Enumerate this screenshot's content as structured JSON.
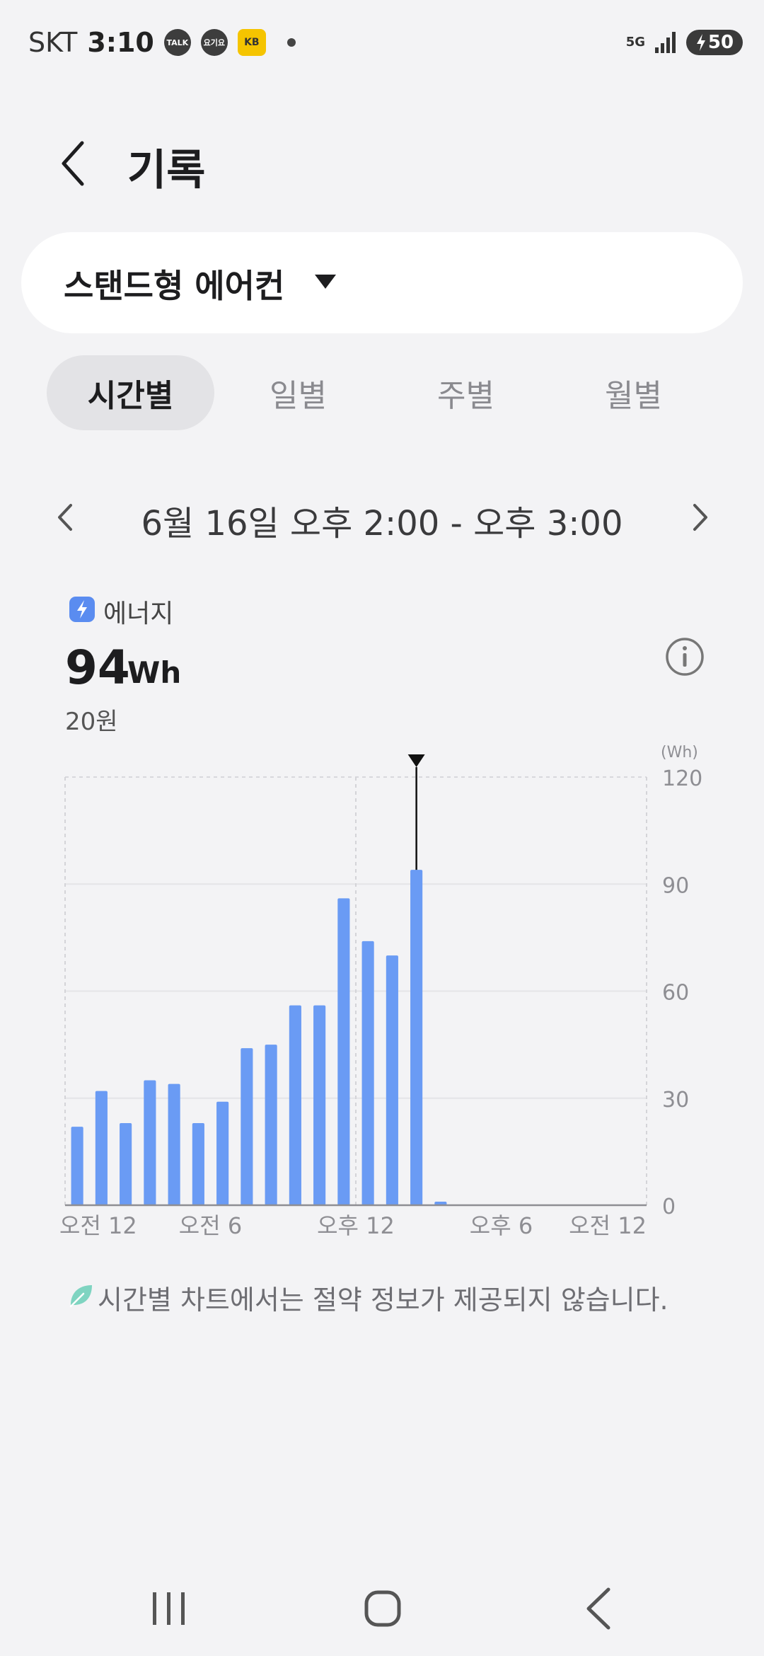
{
  "status_bar": {
    "carrier": "SKT",
    "time": "3:10",
    "notif_icons": [
      "TALK",
      "요기요",
      "KB"
    ],
    "network": "5G",
    "battery": "50"
  },
  "header": {
    "title": "기록"
  },
  "device_selector": {
    "selected": "스탠드형 에어컨"
  },
  "tabs": [
    {
      "label": "시간별",
      "active": true
    },
    {
      "label": "일별",
      "active": false
    },
    {
      "label": "주별",
      "active": false
    },
    {
      "label": "월별",
      "active": false
    }
  ],
  "date_range": "6월 16일 오후 2:00 - 오후 3:00",
  "energy": {
    "label": "에너지",
    "value": "94",
    "unit": "Wh",
    "cost": "20원"
  },
  "chart_data": {
    "type": "bar",
    "unit_label": "(Wh)",
    "ylim": [
      0,
      120
    ],
    "yticks": [
      0,
      30,
      60,
      90,
      120
    ],
    "xtick_labels": [
      "오전 12",
      "오전 6",
      "오후 12",
      "오후 6",
      "오전 12"
    ],
    "xtick_hours": [
      0,
      6,
      12,
      18,
      24
    ],
    "hours": [
      0,
      1,
      2,
      3,
      4,
      5,
      6,
      7,
      8,
      9,
      10,
      11,
      12,
      13,
      14,
      15,
      16,
      17,
      18,
      19,
      20,
      21,
      22,
      23
    ],
    "values": [
      22,
      32,
      23,
      35,
      34,
      23,
      29,
      44,
      45,
      56,
      56,
      86,
      74,
      70,
      94,
      1,
      0,
      0,
      0,
      0,
      0,
      0,
      0,
      0
    ],
    "selected_index": 14,
    "bar_color": "#6a9bf4"
  },
  "footer_note": "시간별 차트에서는 절약 정보가 제공되지 않습니다.",
  "colors": {
    "accent": "#6a9bf4",
    "leaf": "#7fd4c1"
  }
}
